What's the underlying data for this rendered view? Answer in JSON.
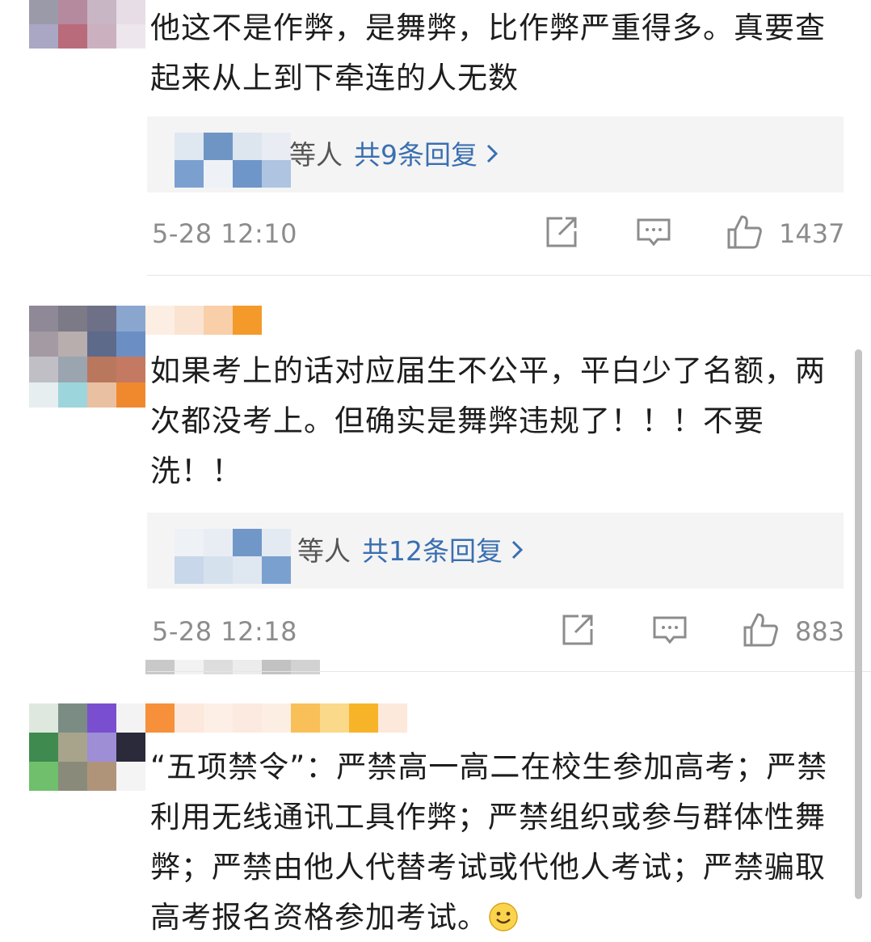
{
  "comments": [
    {
      "text": "他这不是作弊，是舞弊，比作弊严重得多。真要查起来从上到下牵连的人无数",
      "replies_who": "等人",
      "replies_count": "共9条回复",
      "time": "5-28 12:10",
      "likes": "1437"
    },
    {
      "text": "如果考上的话对应届生不公平，平白少了名额，两次都没考上。但确实是舞弊违规了！！！不要洗！！",
      "replies_who": "等人",
      "replies_count": "共12条回复",
      "time": "5-28 12:18",
      "likes": "883"
    },
    {
      "text": "“五项禁令”：严禁高一高二在校生参加高考；严禁利用无线通讯工具作弊；严禁组织或参与群体性舞弊；严禁由他人代替考试或代他人考试；严禁骗取高考报名资格参加考试。"
    }
  ],
  "icons": {
    "share": "share-icon",
    "comment": "comment-icon",
    "like": "thumbs-up-icon",
    "reply_chevron": "chevron-right-icon",
    "emoji": "smile-emoji-icon"
  },
  "colors": {
    "link_blue": "#3a6fb0",
    "meta_gray": "#8c8c8c",
    "reply_bg": "#f4f4f4"
  }
}
